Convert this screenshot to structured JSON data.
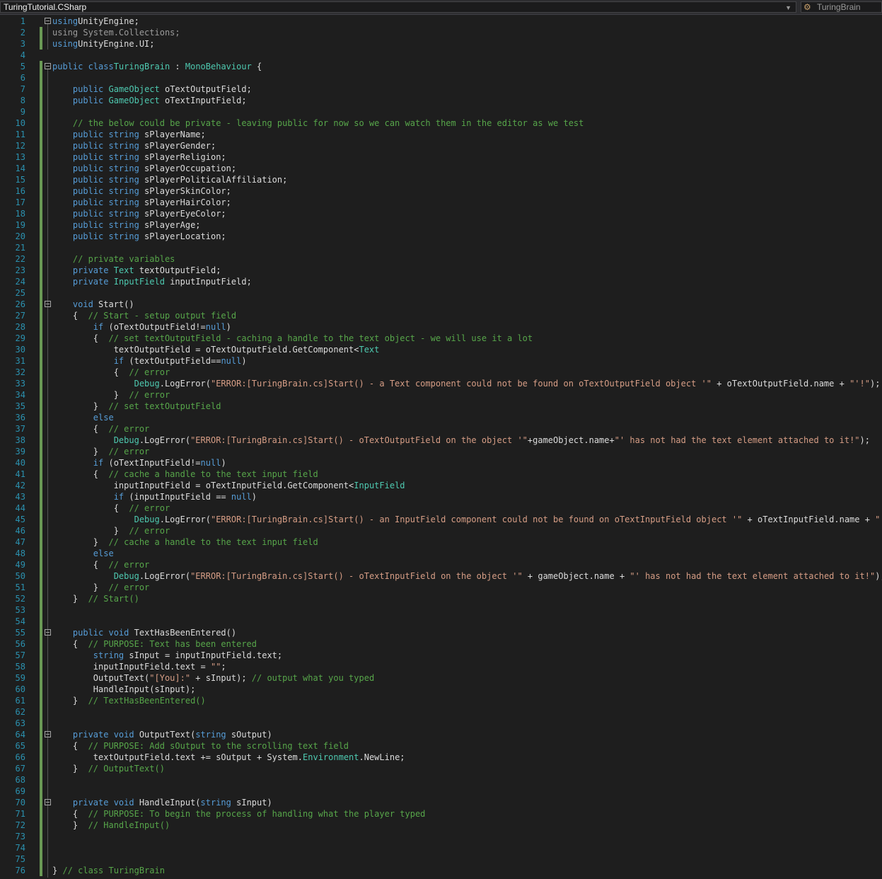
{
  "navbar": {
    "file_scope": "TuringTutorial.CSharp",
    "class_scope": "TuringBrain",
    "class_icon": "class-icon"
  },
  "editor": {
    "lines": [
      [
        [
          "kw",
          "using"
        ],
        [
          "",
          "UnityEngine;"
        ]
      ],
      [
        [
          "dim",
          "using System.Collections;"
        ]
      ],
      [
        [
          "kw",
          "using"
        ],
        [
          "",
          "UnityEngine.UI;"
        ]
      ],
      [],
      [
        [
          "kw",
          "public class"
        ],
        [
          "ty",
          "TuringBrain"
        ],
        [
          "",
          " : "
        ],
        [
          "ty",
          "MonoBehaviour"
        ],
        [
          "",
          " {"
        ]
      ],
      [],
      [
        [
          "",
          "    "
        ],
        [
          "kw",
          "public"
        ],
        [
          "",
          " "
        ],
        [
          "ty",
          "GameObject"
        ],
        [
          "",
          " oTextOutputField;"
        ]
      ],
      [
        [
          "",
          "    "
        ],
        [
          "kw",
          "public"
        ],
        [
          "",
          " "
        ],
        [
          "ty",
          "GameObject"
        ],
        [
          "",
          " oTextInputField;"
        ]
      ],
      [],
      [
        [
          "",
          "    "
        ],
        [
          "cm",
          "// the below could be private - leaving public for now so we can watch them in the editor as we test"
        ]
      ],
      [
        [
          "",
          "    "
        ],
        [
          "kw",
          "public string"
        ],
        [
          "",
          " sPlayerName;"
        ]
      ],
      [
        [
          "",
          "    "
        ],
        [
          "kw",
          "public string"
        ],
        [
          "",
          " sPlayerGender;"
        ]
      ],
      [
        [
          "",
          "    "
        ],
        [
          "kw",
          "public string"
        ],
        [
          "",
          " sPlayerReligion;"
        ]
      ],
      [
        [
          "",
          "    "
        ],
        [
          "kw",
          "public string"
        ],
        [
          "",
          " sPlayerOccupation;"
        ]
      ],
      [
        [
          "",
          "    "
        ],
        [
          "kw",
          "public string"
        ],
        [
          "",
          " sPlayerPoliticalAffiliation;"
        ]
      ],
      [
        [
          "",
          "    "
        ],
        [
          "kw",
          "public string"
        ],
        [
          "",
          " sPlayerSkinColor;"
        ]
      ],
      [
        [
          "",
          "    "
        ],
        [
          "kw",
          "public string"
        ],
        [
          "",
          " sPlayerHairColor;"
        ]
      ],
      [
        [
          "",
          "    "
        ],
        [
          "kw",
          "public string"
        ],
        [
          "",
          " sPlayerEyeColor;"
        ]
      ],
      [
        [
          "",
          "    "
        ],
        [
          "kw",
          "public string"
        ],
        [
          "",
          " sPlayerAge;"
        ]
      ],
      [
        [
          "",
          "    "
        ],
        [
          "kw",
          "public string"
        ],
        [
          "",
          " sPlayerLocation;"
        ]
      ],
      [],
      [
        [
          "",
          "    "
        ],
        [
          "cm",
          "// private variables"
        ]
      ],
      [
        [
          "",
          "    "
        ],
        [
          "kw",
          "private"
        ],
        [
          "",
          " "
        ],
        [
          "ty",
          "Text"
        ],
        [
          "",
          " textOutputField;"
        ]
      ],
      [
        [
          "",
          "    "
        ],
        [
          "kw",
          "private"
        ],
        [
          "",
          " "
        ],
        [
          "ty",
          "InputField"
        ],
        [
          "",
          " inputInputField;"
        ]
      ],
      [],
      [
        [
          "",
          "    "
        ],
        [
          "kw",
          "void"
        ],
        [
          "",
          " Start()"
        ]
      ],
      [
        [
          "",
          "    {  "
        ],
        [
          "cm",
          "// Start - setup output field"
        ]
      ],
      [
        [
          "",
          "        "
        ],
        [
          "kw",
          "if"
        ],
        [
          "",
          " (oTextOutputField!="
        ],
        [
          "kw",
          "null"
        ],
        [
          "",
          ")"
        ]
      ],
      [
        [
          "",
          "        {  "
        ],
        [
          "cm",
          "// set textOutputField - caching a handle to the text object - we will use it a lot"
        ]
      ],
      [
        [
          "",
          "            textOutputField = oTextOutputField.GetComponent<"
        ],
        [
          "ty",
          "Text"
        ],
        [
          ">();"
        ]
      ],
      [
        [
          "",
          "            "
        ],
        [
          "kw",
          "if"
        ],
        [
          "",
          " (textOutputField=="
        ],
        [
          "kw",
          "null"
        ],
        [
          "",
          ")"
        ]
      ],
      [
        [
          "",
          "            {  "
        ],
        [
          "cm",
          "// error"
        ]
      ],
      [
        [
          "",
          "                "
        ],
        [
          "ty",
          "Debug"
        ],
        [
          "",
          ".LogError("
        ],
        [
          "st",
          "\"ERROR:[TuringBrain.cs]Start() - a Text component could not be found on oTextOutputField object '\""
        ],
        [
          "",
          " + oTextOutputField.name + "
        ],
        [
          "st",
          "\"'!\""
        ],
        [
          "",
          ");"
        ]
      ],
      [
        [
          "",
          "            }  "
        ],
        [
          "cm",
          "// error"
        ]
      ],
      [
        [
          "",
          "        }  "
        ],
        [
          "cm",
          "// set textOutputField"
        ]
      ],
      [
        [
          "",
          "        "
        ],
        [
          "kw",
          "else"
        ]
      ],
      [
        [
          "",
          "        {  "
        ],
        [
          "cm",
          "// error"
        ]
      ],
      [
        [
          "",
          "            "
        ],
        [
          "ty",
          "Debug"
        ],
        [
          "",
          ".LogError("
        ],
        [
          "st",
          "\"ERROR:[TuringBrain.cs]Start() - oTextOutputField on the object '\""
        ],
        [
          "",
          "+gameObject.name+"
        ],
        [
          "st",
          "\"' has not had the text element attached to it!\""
        ],
        [
          "",
          ");"
        ]
      ],
      [
        [
          "",
          "        }  "
        ],
        [
          "cm",
          "// error"
        ]
      ],
      [
        [
          "",
          "        "
        ],
        [
          "kw",
          "if"
        ],
        [
          "",
          " (oTextInputField!="
        ],
        [
          "kw",
          "null"
        ],
        [
          "",
          ")"
        ]
      ],
      [
        [
          "",
          "        {  "
        ],
        [
          "cm",
          "// cache a handle to the text input field"
        ]
      ],
      [
        [
          "",
          "            inputInputField = oTextInputField.GetComponent<"
        ],
        [
          "ty",
          "InputField"
        ],
        [
          ">();"
        ]
      ],
      [
        [
          "",
          "            "
        ],
        [
          "kw",
          "if"
        ],
        [
          "",
          " (inputInputField == "
        ],
        [
          "kw",
          "null"
        ],
        [
          "",
          ")"
        ]
      ],
      [
        [
          "",
          "            {  "
        ],
        [
          "cm",
          "// error"
        ]
      ],
      [
        [
          "",
          "                "
        ],
        [
          "ty",
          "Debug"
        ],
        [
          "",
          ".LogError("
        ],
        [
          "st",
          "\"ERROR:[TuringBrain.cs]Start() - an InputField component could not be found on oTextInputField object '\""
        ],
        [
          "",
          " + oTextInputField.name + "
        ],
        [
          "st",
          "\"'!\""
        ],
        [
          "",
          ");"
        ]
      ],
      [
        [
          "",
          "            }  "
        ],
        [
          "cm",
          "// error"
        ]
      ],
      [
        [
          "",
          "        }  "
        ],
        [
          "cm",
          "// cache a handle to the text input field"
        ]
      ],
      [
        [
          "",
          "        "
        ],
        [
          "kw",
          "else"
        ]
      ],
      [
        [
          "",
          "        {  "
        ],
        [
          "cm",
          "// error"
        ]
      ],
      [
        [
          "",
          "            "
        ],
        [
          "ty",
          "Debug"
        ],
        [
          "",
          ".LogError("
        ],
        [
          "st",
          "\"ERROR:[TuringBrain.cs]Start() - oTextInputField on the object '\""
        ],
        [
          "",
          " + gameObject.name + "
        ],
        [
          "st",
          "\"' has not had the text element attached to it!\""
        ],
        [
          "",
          ");"
        ]
      ],
      [
        [
          "",
          "        }  "
        ],
        [
          "cm",
          "// error"
        ]
      ],
      [
        [
          "",
          "    }  "
        ],
        [
          "cm",
          "// Start()"
        ]
      ],
      [],
      [],
      [
        [
          "",
          "    "
        ],
        [
          "kw",
          "public void"
        ],
        [
          "",
          " TextHasBeenEntered()"
        ]
      ],
      [
        [
          "",
          "    {  "
        ],
        [
          "cm",
          "// PURPOSE: Text has been entered"
        ]
      ],
      [
        [
          "",
          "        "
        ],
        [
          "kw",
          "string"
        ],
        [
          "",
          " sInput = inputInputField.text;"
        ]
      ],
      [
        [
          "",
          "        inputInputField.text = "
        ],
        [
          "st",
          "\"\""
        ],
        [
          "",
          ";"
        ]
      ],
      [
        [
          "",
          "        OutputText("
        ],
        [
          "st",
          "\"[You]:\""
        ],
        [
          "",
          " + sInput); "
        ],
        [
          "cm",
          "// output what you typed"
        ]
      ],
      [
        [
          "",
          "        HandleInput(sInput);"
        ]
      ],
      [
        [
          "",
          "    }  "
        ],
        [
          "cm",
          "// TextHasBeenEntered()"
        ]
      ],
      [],
      [],
      [
        [
          "",
          "    "
        ],
        [
          "kw",
          "private void"
        ],
        [
          "",
          " OutputText("
        ],
        [
          "kw",
          "string"
        ],
        [
          "",
          " sOutput)"
        ]
      ],
      [
        [
          "",
          "    {  "
        ],
        [
          "cm",
          "// PURPOSE: Add sOutput to the scrolling text field"
        ]
      ],
      [
        [
          "",
          "        textOutputField.text += sOutput + System."
        ],
        [
          "ty",
          "Environment"
        ],
        [
          "",
          ".NewLine;"
        ]
      ],
      [
        [
          "",
          "    }  "
        ],
        [
          "cm",
          "// OutputText()"
        ]
      ],
      [],
      [],
      [
        [
          "",
          "    "
        ],
        [
          "kw",
          "private void"
        ],
        [
          "",
          " HandleInput("
        ],
        [
          "kw",
          "string"
        ],
        [
          "",
          " sInput)"
        ]
      ],
      [
        [
          "",
          "    {  "
        ],
        [
          "cm",
          "// PURPOSE: To begin the process of handling what the player typed"
        ]
      ],
      [
        [
          "",
          "    }  "
        ],
        [
          "cm",
          "// HandleInput()"
        ]
      ],
      [],
      [],
      [],
      [
        [
          "",
          "} "
        ],
        [
          "cm",
          "// class TuringBrain"
        ]
      ]
    ]
  }
}
